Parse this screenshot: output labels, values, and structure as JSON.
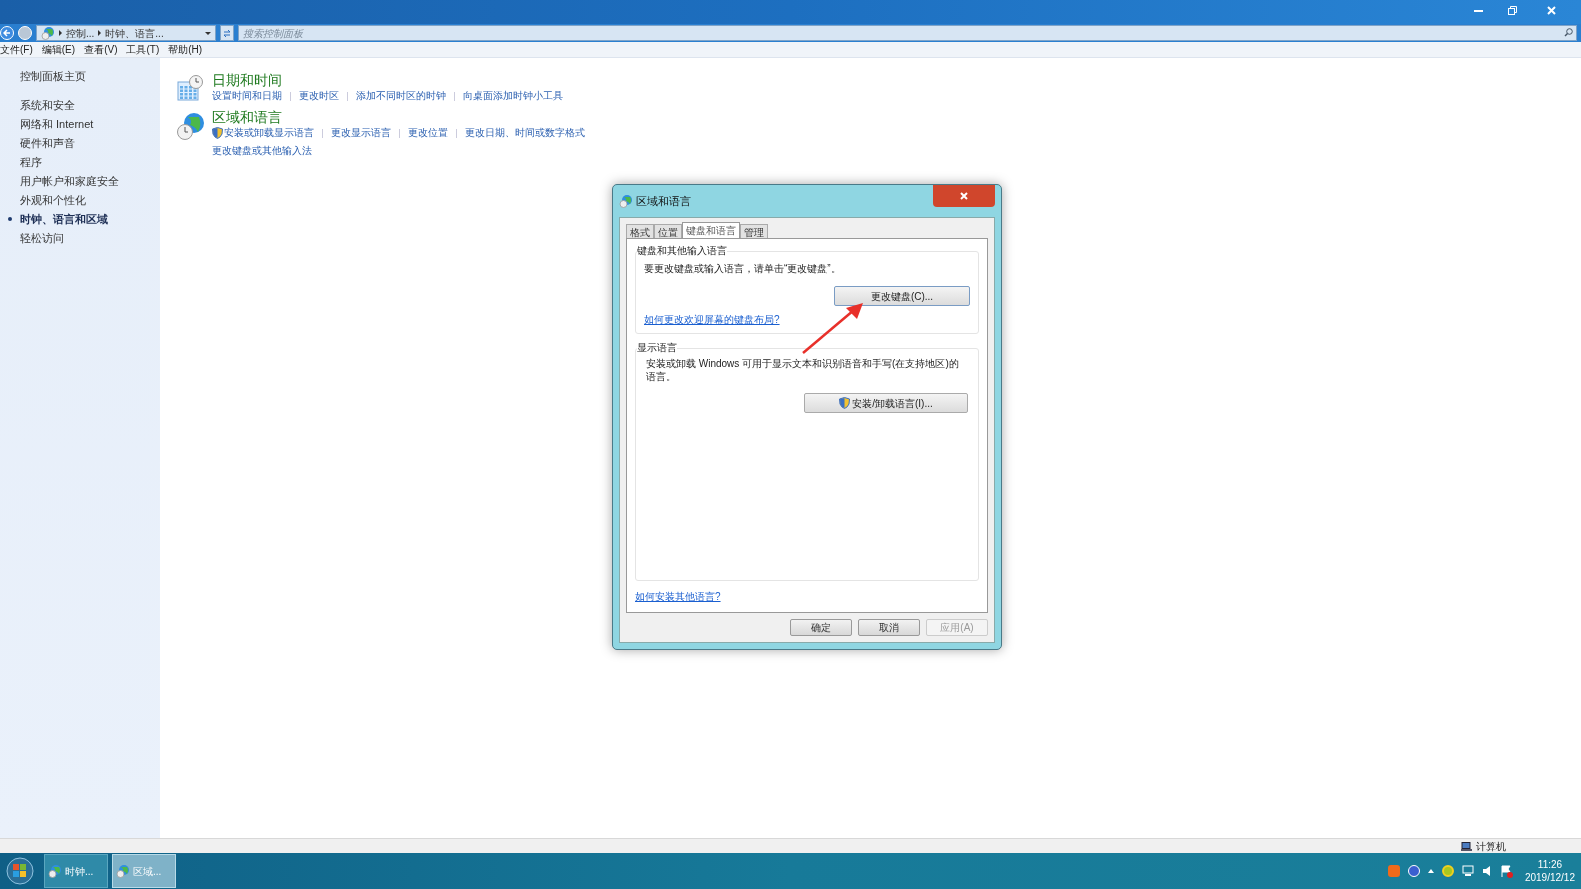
{
  "address_bar": {
    "breadcrumbs": [
      "控制...",
      "时钟、语言..."
    ],
    "search": {
      "placeholder": "搜索控制面板"
    }
  },
  "menu_bar": [
    "文件(F)",
    "编辑(E)",
    "查看(V)",
    "工具(T)",
    "帮助(H)"
  ],
  "sidebar": {
    "home": "控制面板主页",
    "items": [
      {
        "label": "系统和安全",
        "selected": false
      },
      {
        "label": "网络和 Internet",
        "selected": false
      },
      {
        "label": "硬件和声音",
        "selected": false
      },
      {
        "label": "程序",
        "selected": false
      },
      {
        "label": "用户帐户和家庭安全",
        "selected": false
      },
      {
        "label": "外观和个性化",
        "selected": false
      },
      {
        "label": "时钟、语言和区域",
        "selected": true
      },
      {
        "label": "轻松访问",
        "selected": false
      }
    ]
  },
  "categories": [
    {
      "kind": "calendar",
      "title": "日期和时间",
      "links": [
        {
          "label": "设置时间和日期",
          "shield": false
        },
        {
          "label": "更改时区",
          "shield": false
        },
        {
          "label": "添加不同时区的时钟",
          "shield": false
        },
        {
          "label": "向桌面添加时钟小工具",
          "shield": false
        }
      ]
    },
    {
      "kind": "globe",
      "title": "区域和语言",
      "links": [
        {
          "label": "安装或卸载显示语言",
          "shield": true
        },
        {
          "label": "更改显示语言",
          "shield": false
        },
        {
          "label": "更改位置",
          "shield": false
        },
        {
          "label": "更改日期、时间或数字格式",
          "shield": false
        },
        {
          "label": "更改键盘或其他输入法",
          "shield": false
        }
      ]
    }
  ],
  "dialog": {
    "title": "区域和语言",
    "tabs": [
      {
        "label": "格式",
        "selected": false
      },
      {
        "label": "位置",
        "selected": false
      },
      {
        "label": "键盘和语言",
        "selected": true
      },
      {
        "label": "管理",
        "selected": false
      }
    ],
    "keyboard_group": {
      "heading": "键盘和其他输入语言",
      "description": "要更改键盘或输入语言，请单击“更改键盘”。",
      "button": "更改键盘(C)...",
      "link": "如何更改欢迎屏幕的键盘布局?"
    },
    "display_group": {
      "heading": "显示语言",
      "description": "安装或卸载 Windows 可用于显示文本和识别语音和手写(在支持地区)的语言。",
      "button": "安装/卸载语言(I)..."
    },
    "link": "如何安装其他语言?",
    "buttons": [
      {
        "label": "确定",
        "disabled": false
      },
      {
        "label": "取消",
        "disabled": false
      },
      {
        "label": "应用(A)",
        "disabled": true
      }
    ]
  },
  "status_bar": "计算机",
  "taskbar": {
    "items": [
      {
        "label": "时钟...",
        "selected": false
      },
      {
        "label": "区域...",
        "selected": true
      }
    ],
    "time": "11:26",
    "date": "2019/12/12"
  }
}
